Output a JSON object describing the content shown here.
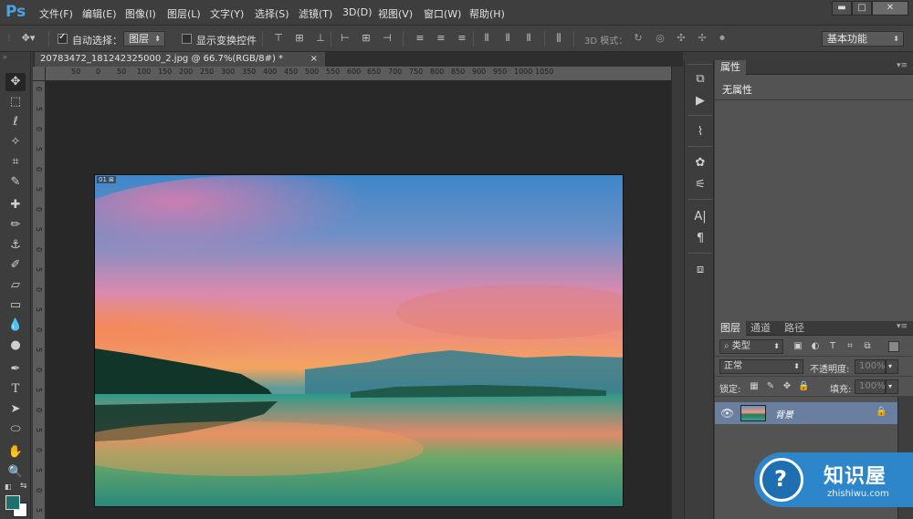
{
  "app": {
    "logo": "Ps"
  },
  "menu": [
    "文件(F)",
    "编辑(E)",
    "图像(I)",
    "图层(L)",
    "文字(Y)",
    "选择(S)",
    "滤镜(T)",
    "3D(D)",
    "视图(V)",
    "窗口(W)",
    "帮助(H)"
  ],
  "window_controls": {
    "minimize": "▬",
    "maximize": "□",
    "close": "✕"
  },
  "options": {
    "auto_select_label": "自动选择：",
    "auto_select_checked": true,
    "auto_select_target": "图层",
    "show_transform_label": "显示变换控件",
    "show_transform_checked": false,
    "mode_3d_label": "3D 模式：",
    "workspace": "基本功能"
  },
  "document": {
    "tab_title": "20783472_181242325000_2.jpg @ 66.7%(RGB/8#) *",
    "tab_close": "×",
    "ruler_h": [
      "50",
      "0",
      "50",
      "100",
      "150",
      "200",
      "250",
      "300",
      "350",
      "400",
      "450",
      "500",
      "550",
      "600",
      "650",
      "700",
      "750",
      "800",
      "850",
      "900",
      "950",
      "1000",
      "1050"
    ],
    "ruler_v": [
      "0",
      "5",
      "0",
      "5",
      "0",
      "5",
      "0",
      "5",
      "0",
      "5",
      "0",
      "5",
      "0",
      "5",
      "0",
      "5",
      "0",
      "5",
      "0",
      "5",
      "0",
      "5",
      "0"
    ],
    "photo_tag": "01 ⊠"
  },
  "properties": {
    "tab_label": "属性",
    "content": "无属性"
  },
  "layers": {
    "tabs": [
      "图层",
      "通道",
      "路径"
    ],
    "filter_type": "类型",
    "blend_mode": "正常",
    "opacity_label": "不透明度:",
    "opacity_value": "100%",
    "lock_label": "锁定:",
    "fill_label": "填充:",
    "fill_value": "100%",
    "items": [
      {
        "name": "背景",
        "visible": true,
        "locked": true
      }
    ]
  },
  "watermark": {
    "title": "知识屋",
    "url": "zhishiwu.com"
  },
  "colors": {
    "accent": "#4aa3df",
    "foreground_swatch": "#1f6f6a",
    "background_swatch": "#ffffff",
    "selected_layer": "#6a7ea0"
  }
}
